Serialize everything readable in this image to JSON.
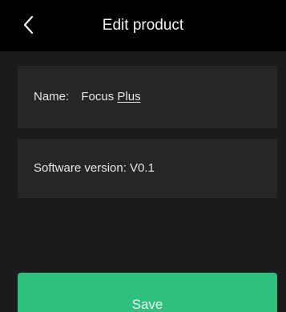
{
  "header": {
    "title": "Edit product",
    "back_icon": "chevron-left-icon"
  },
  "product": {
    "name_label": "Name:",
    "name_value_prefix": "Focus",
    "name_value_underlined": "Plus",
    "version_text": "Software version: V0.1"
  },
  "actions": {
    "save_label": "Save"
  },
  "colors": {
    "header_bg": "#000000",
    "page_bg": "#1b1b1b",
    "card_bg": "#262626",
    "accent": "#2fbf7f",
    "text": "#e6e6e6"
  }
}
